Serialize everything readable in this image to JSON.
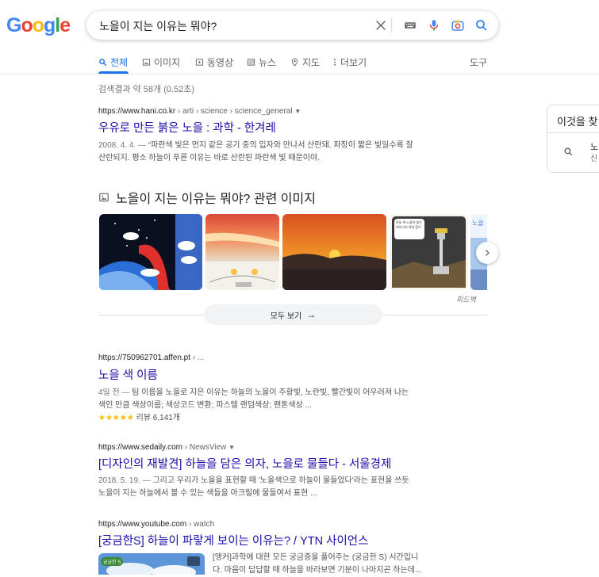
{
  "logo": {
    "letters": [
      "G",
      "o",
      "o",
      "g",
      "l",
      "e"
    ],
    "colors": [
      "#4285f4",
      "#ea4335",
      "#fbbc05",
      "#4285f4",
      "#34a853",
      "#ea4335"
    ]
  },
  "search": {
    "query": "노을이 지는 이유는 뭐야?"
  },
  "tabs": [
    {
      "label": "전체",
      "icon": "search-icon"
    },
    {
      "label": "이미지",
      "icon": "image-icon"
    },
    {
      "label": "동영상",
      "icon": "video-icon"
    },
    {
      "label": "뉴스",
      "icon": "news-icon"
    },
    {
      "label": "지도",
      "icon": "map-pin-icon"
    },
    {
      "label": "더보기",
      "icon": "more-vert-icon"
    }
  ],
  "tools_label": "도구",
  "stats": "검색결과 약 58개 (0.52초)",
  "results": [
    {
      "url": "https://www.hani.co.kr",
      "path": " › arti › science › science_general",
      "title": "우유로 만든 붉은 노을 : 과학 - 한겨레",
      "date": "2008. 4. 4. — ",
      "line1": "“파란색 빛은 먼지 같은 공기 중의 입자와 만나서 산란돼. 파장이 짧은 빛일수록 잘",
      "line2": "산란되지. 평소 하늘이 푸른 이유는 바로 산란된 파란색 빛 때문이야."
    },
    {
      "url": "https://750962701.affen.pt",
      "path": " › ...",
      "title": "노을 색 이름",
      "date": "4일 전 — ",
      "line1": "팀 이름을 노을로 지은 이유는 하늘의 노을이 주황빛, 노란빛, 빨간빛이 어우러져 나는",
      "line2": "색인 만큼 색상이름; 색상코드 변환; 파스텔 랜덤색상; 팬톤색상 ...",
      "rating": "★★★★★",
      "reviews": "리뷰 6,141개"
    },
    {
      "url": "https://www.sedaily.com",
      "path": " › NewsView",
      "title": "[디자인의 재발견] 하늘을 담은 의자, 노을로 물들다 - 서울경제",
      "date": "2018. 5. 19. — ",
      "line1": "그리고 우리가 노을을 표현할 때 '노을색으로 하늘이 물들었다'라는 표현을 쓰듯",
      "line2": "노을이 지는 하늘에서 볼 수 있는 색들을 아크릴에 물들여서 표현 ..."
    },
    {
      "url": "https://www.youtube.com",
      "path": " › watch",
      "title": "[궁금한S] 하늘이 파랗게 보이는 이유는? / YTN 사이언스",
      "line1": "[앵커]과학에 대한 모든 궁금증을 풀어주는 (궁금한 S) 시간입니",
      "line2": "다. 마음이 답답할 때 하늘을 바라보면 기분이 나아지곤 하는데..."
    }
  ],
  "images": {
    "heading": "노을이 지는 이유는 뭐야? 관련 이미지",
    "feedback": "피드백",
    "see_all": "모두 보기",
    "thumb_texts": [
      "하늘 색 노을의 빛은 여러가지 색의 합이",
      "노을"
    ]
  },
  "knowledge_panel": {
    "title": "이것을 찾",
    "item_line1": "노",
    "item_line2": "신"
  },
  "video_badge": "궁금한 S"
}
